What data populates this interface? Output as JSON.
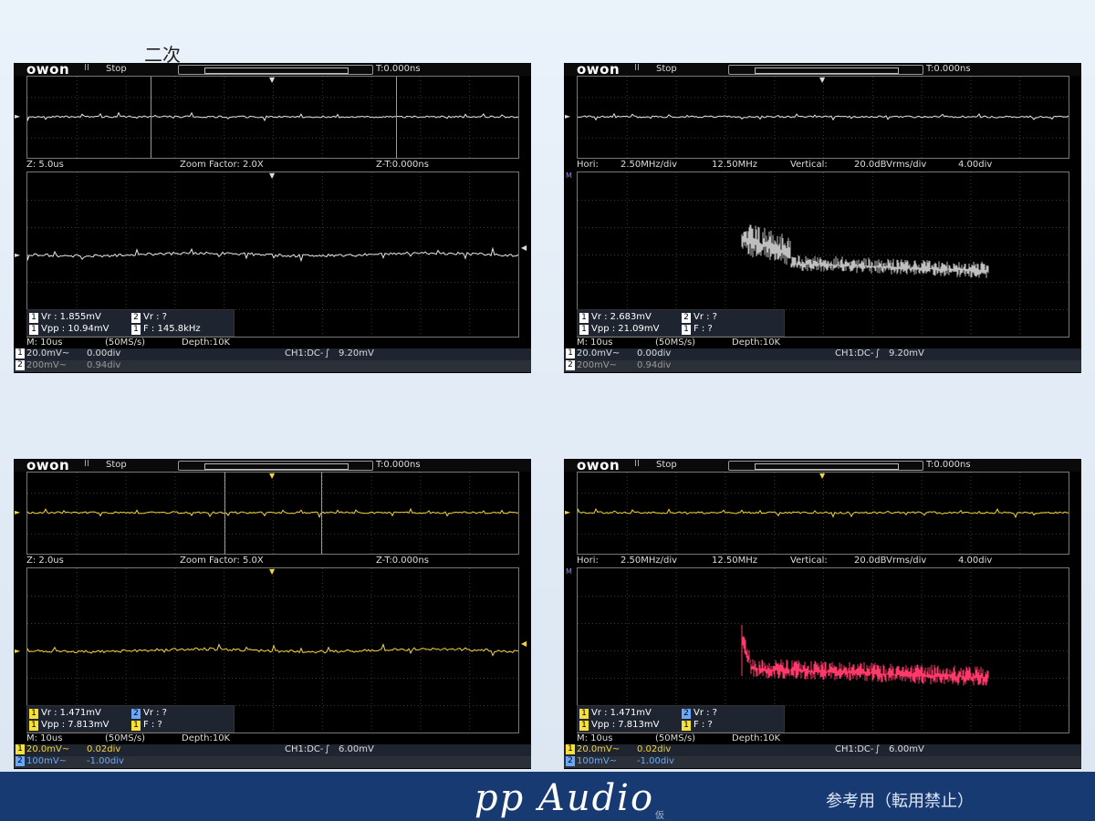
{
  "page": {
    "top_note": "二次",
    "footer_brand": "pp Audio",
    "footer_brand_sub": "仮",
    "footer_note": "参考用（転用禁止）"
  },
  "colors": {
    "trace_white": "#e6e6e6",
    "trace_yellow": "#f2d43c",
    "trace_pink": "#ff3a6a",
    "footer": "#173a73",
    "grid": "#3c3c3c"
  },
  "panels": [
    {
      "id": "p1",
      "logo": "owon",
      "run": "II",
      "status": "Stop",
      "trigger_time": "T:0.000ns",
      "mode": "zoom",
      "mid": {
        "left": "Z: 5.0us",
        "center": "Zoom Factor: 2.0X",
        "right": "Z-T:0.000ns"
      },
      "trace_color": "#e6e6e6",
      "meas": {
        "vr1": "Vr : 1.855mV",
        "vr2": "Vr :     ?",
        "vpp": "Vpp : 10.94mV",
        "f": "F : 145.8kHz"
      },
      "bottom": {
        "m": "M: 10us",
        "rate": "(50MS/s)",
        "depth": "Depth:10K"
      },
      "ch1": {
        "volts": "20.0mV~",
        "div": "0.00div",
        "trig": "CH1:DC-",
        "level": "9.20mV"
      },
      "ch2": {
        "volts": "200mV~",
        "div": "0.94div"
      }
    },
    {
      "id": "p2",
      "logo": "owon",
      "run": "II",
      "status": "Stop",
      "trigger_time": "T:0.000ns",
      "mode": "fft",
      "mid": {
        "hori_label": "Hori:",
        "hori": "2.50MHz/div",
        "center": "12.50MHz",
        "vert_label": "Vertical:",
        "vert": "20.0dBVrms/div",
        "vdiv": "4.00div"
      },
      "trace_color": "#e6e6e6",
      "fft_color": "#bfbfbf",
      "meas": {
        "vr1": "Vr : 2.683mV",
        "vr2": "Vr :     ?",
        "vpp": "Vpp : 21.09mV",
        "f": "F :     ?"
      },
      "bottom": {
        "m": "M: 10us",
        "rate": "(50MS/s)",
        "depth": "Depth:10K"
      },
      "ch1": {
        "volts": "20.0mV~",
        "div": "0.00div",
        "trig": "CH1:DC-",
        "level": "9.20mV"
      },
      "ch2": {
        "volts": "200mV~",
        "div": "0.94div"
      }
    },
    {
      "id": "p3",
      "logo": "owon",
      "run": "II",
      "status": "Stop",
      "trigger_time": "T:0.000ns",
      "mode": "zoom",
      "mid": {
        "left": "Z: 2.0us",
        "center": "Zoom Factor: 5.0X",
        "right": "Z-T:0.000ns"
      },
      "trace_color": "#f2d43c",
      "meas": {
        "vr1": "Vr : 1.471mV",
        "vr2": "Vr :     ?",
        "vpp": "Vpp : 7.813mV",
        "f": "F :     ?"
      },
      "bottom": {
        "m": "M: 10us",
        "rate": "(50MS/s)",
        "depth": "Depth:10K"
      },
      "ch1": {
        "volts": "20.0mV~",
        "div": "0.02div",
        "trig": "CH1:DC-",
        "level": "6.00mV"
      },
      "ch2": {
        "volts": "100mV~",
        "div": "-1.00div"
      }
    },
    {
      "id": "p4",
      "logo": "owon",
      "run": "II",
      "status": "Stop",
      "trigger_time": "T:0.000ns",
      "mode": "fft",
      "mid": {
        "hori_label": "Hori:",
        "hori": "2.50MHz/div",
        "center": "12.50MHz",
        "vert_label": "Vertical:",
        "vert": "20.0dBVrms/div",
        "vdiv": "4.00div"
      },
      "trace_color": "#f2d43c",
      "fft_color": "#ff3a6a",
      "meas": {
        "vr1": "Vr : 1.471mV",
        "vr2": "Vr :     ?",
        "vpp": "Vpp : 7.813mV",
        "f": "F :     ?"
      },
      "bottom": {
        "m": "M: 10us",
        "rate": "(50MS/s)",
        "depth": "Depth:10K"
      },
      "ch1": {
        "volts": "20.0mV~",
        "div": "0.02div",
        "trig": "CH1:DC-",
        "level": "6.00mV"
      },
      "ch2": {
        "volts": "100mV~",
        "div": "-1.00div"
      }
    }
  ]
}
